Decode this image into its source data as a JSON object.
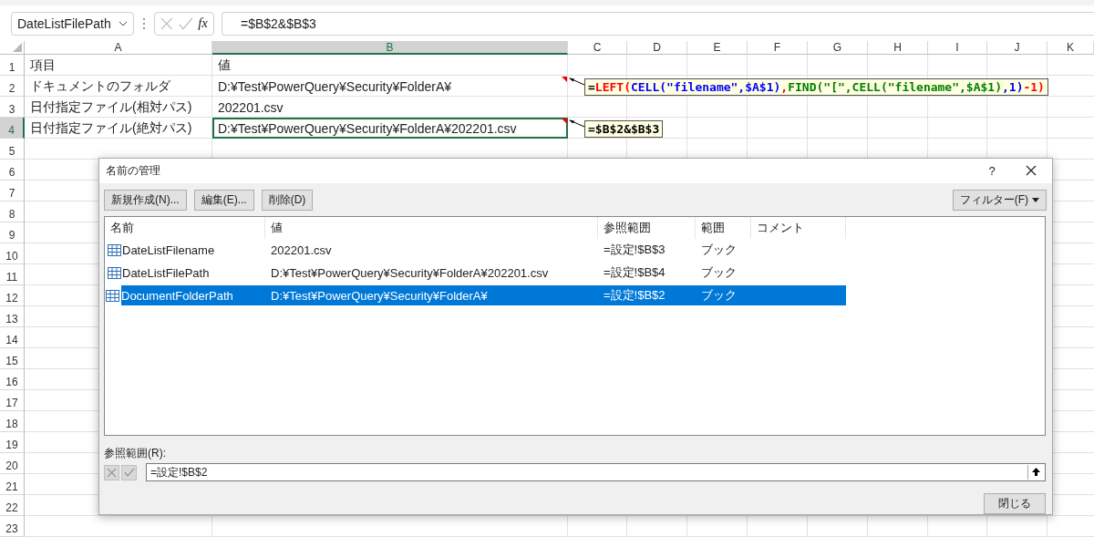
{
  "name_box": {
    "value": "DateListFilePath"
  },
  "formula_bar": {
    "fx": "fx",
    "value": "=$B$2&$B$3"
  },
  "columns": [
    {
      "label": "A",
      "selected": false
    },
    {
      "label": "B",
      "selected": true
    },
    {
      "label": "C",
      "selected": false
    },
    {
      "label": "D",
      "selected": false
    },
    {
      "label": "E",
      "selected": false
    },
    {
      "label": "F",
      "selected": false
    },
    {
      "label": "G",
      "selected": false
    },
    {
      "label": "H",
      "selected": false
    },
    {
      "label": "I",
      "selected": false
    },
    {
      "label": "J",
      "selected": false
    },
    {
      "label": "K",
      "selected": false
    }
  ],
  "rows": [
    {
      "label": "1",
      "selected": false,
      "cells": [
        {
          "text": "項目",
          "active": false
        },
        {
          "text": "値",
          "active": false
        }
      ]
    },
    {
      "label": "2",
      "selected": false,
      "cells": [
        {
          "text": "ドキュメントのフォルダ",
          "active": false
        },
        {
          "text": "D:¥Test¥PowerQuery¥Security¥FolderA¥",
          "active": false,
          "comment": [
            {
              "text": "=",
              "color": "#000000"
            },
            {
              "text": "LEFT(",
              "color": "#ff0000"
            },
            {
              "text": "CELL(\"filename\",$A$1)",
              "color": "#0000ff"
            },
            {
              "text": ",",
              "color": "#ff0000"
            },
            {
              "text": "FIND(\"[\",CELL(\"filename\",$A$1)",
              "color": "#008000"
            },
            {
              "text": ",1)",
              "color": "#0000ff"
            },
            {
              "text": "-1)",
              "color": "#ff0000"
            }
          ]
        }
      ]
    },
    {
      "label": "3",
      "selected": false,
      "cells": [
        {
          "text": "日付指定ファイル(相対パス)",
          "active": false
        },
        {
          "text": "202201.csv",
          "active": false
        }
      ]
    },
    {
      "label": "4",
      "selected": true,
      "cells": [
        {
          "text": "日付指定ファイル(絶対パス)",
          "active": false
        },
        {
          "text": "D:¥Test¥PowerQuery¥Security¥FolderA¥202201.csv",
          "active": true,
          "comment": [
            {
              "text": "=$B$2&$B$3",
              "color": "#000000"
            }
          ]
        }
      ]
    },
    {
      "label": "5",
      "selected": false
    },
    {
      "label": "6",
      "selected": false
    },
    {
      "label": "7",
      "selected": false
    },
    {
      "label": "8",
      "selected": false
    },
    {
      "label": "9",
      "selected": false
    },
    {
      "label": "10",
      "selected": false
    },
    {
      "label": "11",
      "selected": false
    },
    {
      "label": "12",
      "selected": false
    },
    {
      "label": "13",
      "selected": false
    },
    {
      "label": "14",
      "selected": false
    },
    {
      "label": "15",
      "selected": false
    },
    {
      "label": "16",
      "selected": false
    },
    {
      "label": "17",
      "selected": false
    },
    {
      "label": "18",
      "selected": false
    },
    {
      "label": "19",
      "selected": false
    },
    {
      "label": "20",
      "selected": false
    },
    {
      "label": "21",
      "selected": false
    },
    {
      "label": "22",
      "selected": false
    },
    {
      "label": "23",
      "selected": false
    }
  ],
  "dialog": {
    "title": "名前の管理",
    "help": "?",
    "buttons": [
      "新規作成(N)...",
      "編集(E)...",
      "削除(D)"
    ],
    "filter_button": "フィルター(F)",
    "columns": [
      "名前",
      "値",
      "参照範囲",
      "範囲",
      "コメント"
    ],
    "rows": [
      {
        "name": "DateListFilename",
        "value": "202201.csv",
        "refers_to": "=設定!$B$3",
        "scope": "ブック",
        "selected": false
      },
      {
        "name": "DateListFilePath",
        "value": "D:¥Test¥PowerQuery¥Security¥FolderA¥202201.csv",
        "refers_to": "=設定!$B$4",
        "scope": "ブック",
        "selected": false
      },
      {
        "name": "DocumentFolderPath",
        "value": "D:¥Test¥PowerQuery¥Security¥FolderA¥",
        "refers_to": "=設定!$B$2",
        "scope": "ブック",
        "selected": true
      }
    ],
    "refers_label": "参照範囲(R):",
    "refers_value": "=設定!$B$2",
    "close_button": "閉じる"
  }
}
